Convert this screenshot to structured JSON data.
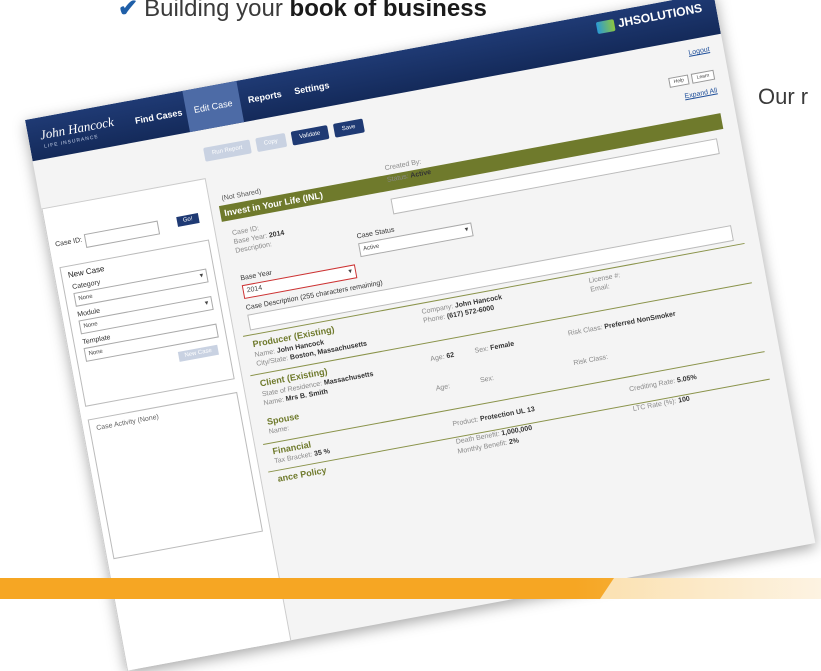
{
  "headline": {
    "check": "✔",
    "prefix": "Building your ",
    "bold": "book of business"
  },
  "side_text": "Our r",
  "colors": {
    "nav": "#1f3a74",
    "olive": "#6f7a2c",
    "orange": "#f6a623"
  },
  "nav": {
    "logo": "John Hancock",
    "logo_sub": "LIFE INSURANCE",
    "items": [
      "Find Cases",
      "Edit Case",
      "Reports",
      "Settings"
    ],
    "brand": "JHSOLUTIONS"
  },
  "logout": "Logout",
  "toolbar": [
    "Run Report",
    "Copy",
    "Validate",
    "Save"
  ],
  "small_buttons": [
    "Help",
    "Learn"
  ],
  "expand_all": "Expand All",
  "left": {
    "case_id_label": "Case ID:",
    "go": "Go!",
    "new_case_title": "New Case",
    "category_label": "Category",
    "category_value": "None",
    "module_label": "Module",
    "module_value": "None",
    "template_label": "Template",
    "template_value": "None",
    "new_case_button": "New Case",
    "activity_title": "Case Activity (None)"
  },
  "main": {
    "not_shared": "(Not Shared)",
    "title": "Invest in Your Life (INL)",
    "created_by": "Created By:",
    "status_label": "Status:",
    "status_value": "Active",
    "case_id_label": "Case ID:",
    "base_year_label": "Base Year:",
    "base_year_value": "2014",
    "description_label": "Description:",
    "case_status_label": "Case Status",
    "case_status_value": "Active",
    "base_year_field_label": "Base Year",
    "base_year_field_value": "2014",
    "case_desc_label": "Case Description (255 characters remaining)",
    "producer_title": "Producer (Existing)",
    "producer_name_label": "Name:",
    "producer_name": "John Hancock",
    "city_label": "City/State:",
    "city": "Boston, Massachusetts",
    "company_label": "Company:",
    "company": "John Hancock",
    "phone_label": "Phone:",
    "phone": "(617) 572-6000",
    "license_label": "License #:",
    "email_label": "Email:",
    "client_title": "Client (Existing)",
    "residence_label": "State of Residence:",
    "residence": "Massachusetts",
    "client_name_label": "Name:",
    "client_name": "Mrs B. Smith",
    "age_label": "Age:",
    "age": "62",
    "sex_label": "Sex:",
    "sex": "Female",
    "risk_label": "Risk Class:",
    "risk": "Preferred NonSmoker",
    "spouse_title": "Spouse",
    "spouse_name_label": "Name:",
    "spouse_age_label": "Age:",
    "spouse_sex_label": "Sex:",
    "spouse_risk_label": "Risk Class:",
    "financial_title": "Financial",
    "tax_label": "Tax Bracket:",
    "tax": "35 %",
    "product_label": "Product:",
    "product": "Protection UL 13",
    "crediting_label": "Crediting Rate:",
    "crediting": "5.05%",
    "policy_title": "ance Policy",
    "death_label": "Death Benefit:",
    "death": "1,000,000",
    "monthly_label": "Monthly Benefit:",
    "monthly": "2%",
    "ltc_label": "LTC Rate (%):",
    "ltc": "100"
  }
}
